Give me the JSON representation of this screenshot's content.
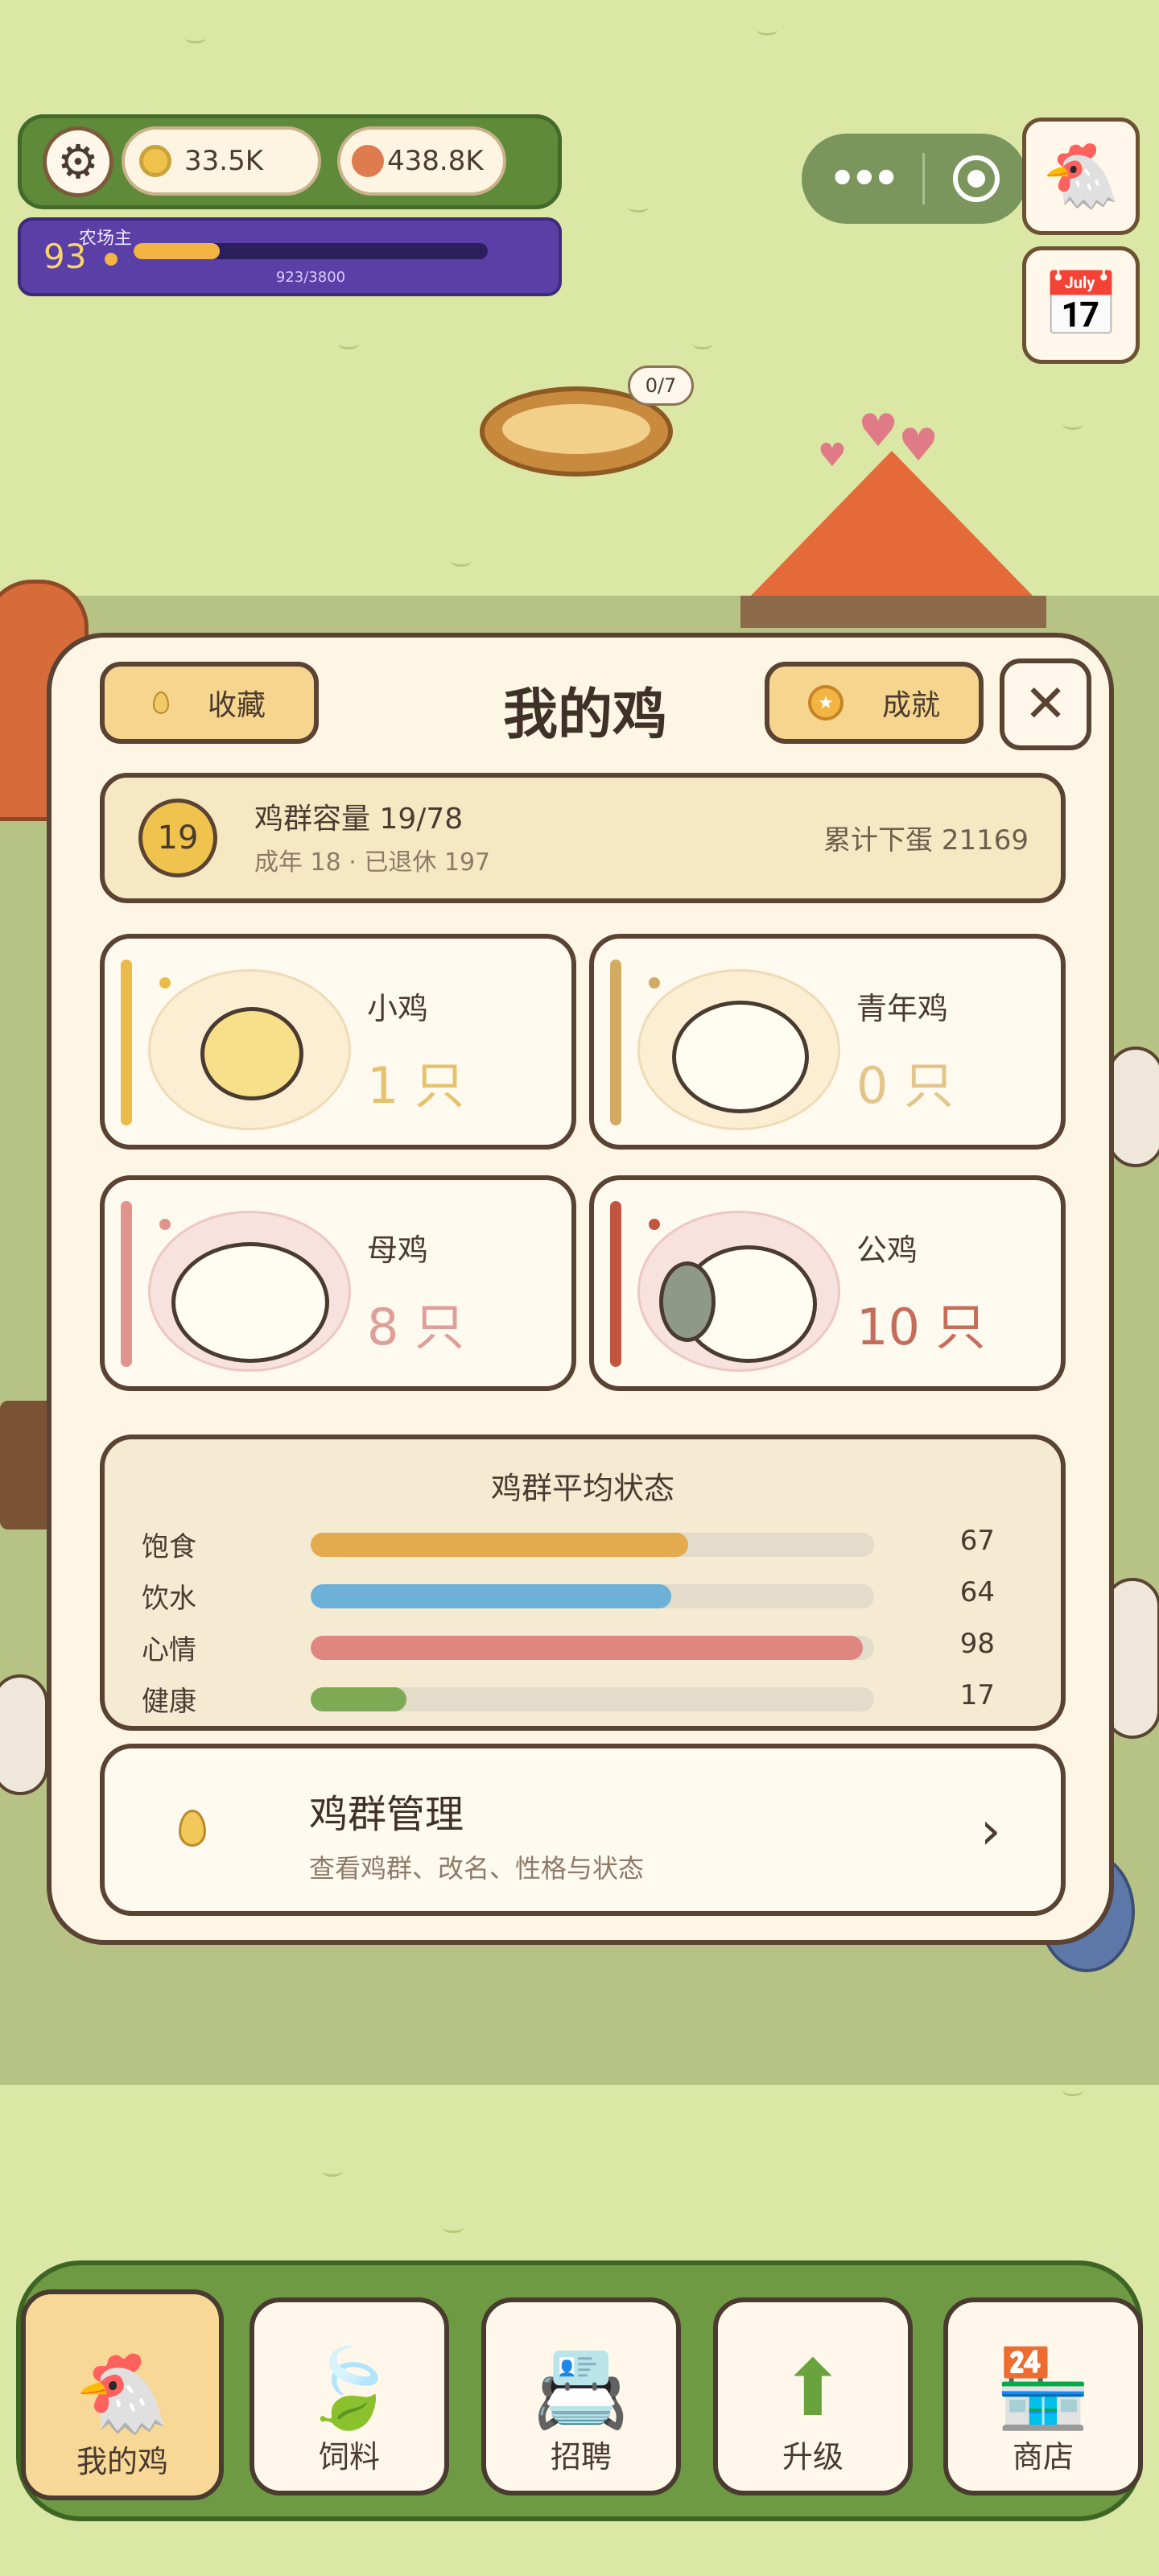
{
  "hud": {
    "coins": "33.5K",
    "seeds": "438.8K",
    "level": "93",
    "level_title": "农场主",
    "xp_text": "923/3800",
    "xp_fraction": 0.243
  },
  "nest_badge": "0/7",
  "dialog": {
    "title": "我的鸡",
    "collection_label": "收藏",
    "achievement_label": "成就",
    "close_symbol": "✕",
    "capacity": {
      "badge": "19",
      "title": "鸡群容量 19/78",
      "sub": "成年 18 · 已退休 197",
      "total_eggs": "累计下蛋 21169"
    },
    "categories": [
      {
        "name": "小鸡",
        "count": "1 只",
        "accent": "#e9bb48",
        "count_color": "#e6c26a"
      },
      {
        "name": "青年鸡",
        "count": "0 只",
        "accent": "#d3aa62",
        "count_color": "#e2c58a"
      },
      {
        "name": "母鸡",
        "count": "8 只",
        "accent": "#e0948c",
        "count_color": "#dd9f98"
      },
      {
        "name": "公鸡",
        "count": "10 只",
        "accent": "#c2553e",
        "count_color": "#c56c5a"
      }
    ],
    "stats": {
      "title": "鸡群平均状态",
      "rows": [
        {
          "label": "饱食",
          "value": "67",
          "fraction": 0.67,
          "color": "#e3aa4e"
        },
        {
          "label": "饮水",
          "value": "64",
          "fraction": 0.64,
          "color": "#6db0d8"
        },
        {
          "label": "心情",
          "value": "98",
          "fraction": 0.98,
          "color": "#e08680"
        },
        {
          "label": "健康",
          "value": "17",
          "fraction": 0.17,
          "color": "#7faa55"
        }
      ]
    },
    "management": {
      "title": "鸡群管理",
      "sub": "查看鸡群、改名、性格与状态",
      "chevron": "›"
    }
  },
  "nav": [
    {
      "label": "我的鸡",
      "icon": "chicken-icon",
      "active": true
    },
    {
      "label": "饲料",
      "icon": "leaf-icon",
      "active": false
    },
    {
      "label": "招聘",
      "icon": "id-badge-icon",
      "active": false
    },
    {
      "label": "升级",
      "icon": "up-arrow-icon",
      "active": false
    },
    {
      "label": "商店",
      "icon": "shop-icon",
      "active": false
    }
  ],
  "colors": {
    "dialog_bg": "#fef6e4",
    "outline": "#5a4333",
    "level_bar": "#5a3fa6",
    "nav_green": "#6f9a44"
  }
}
